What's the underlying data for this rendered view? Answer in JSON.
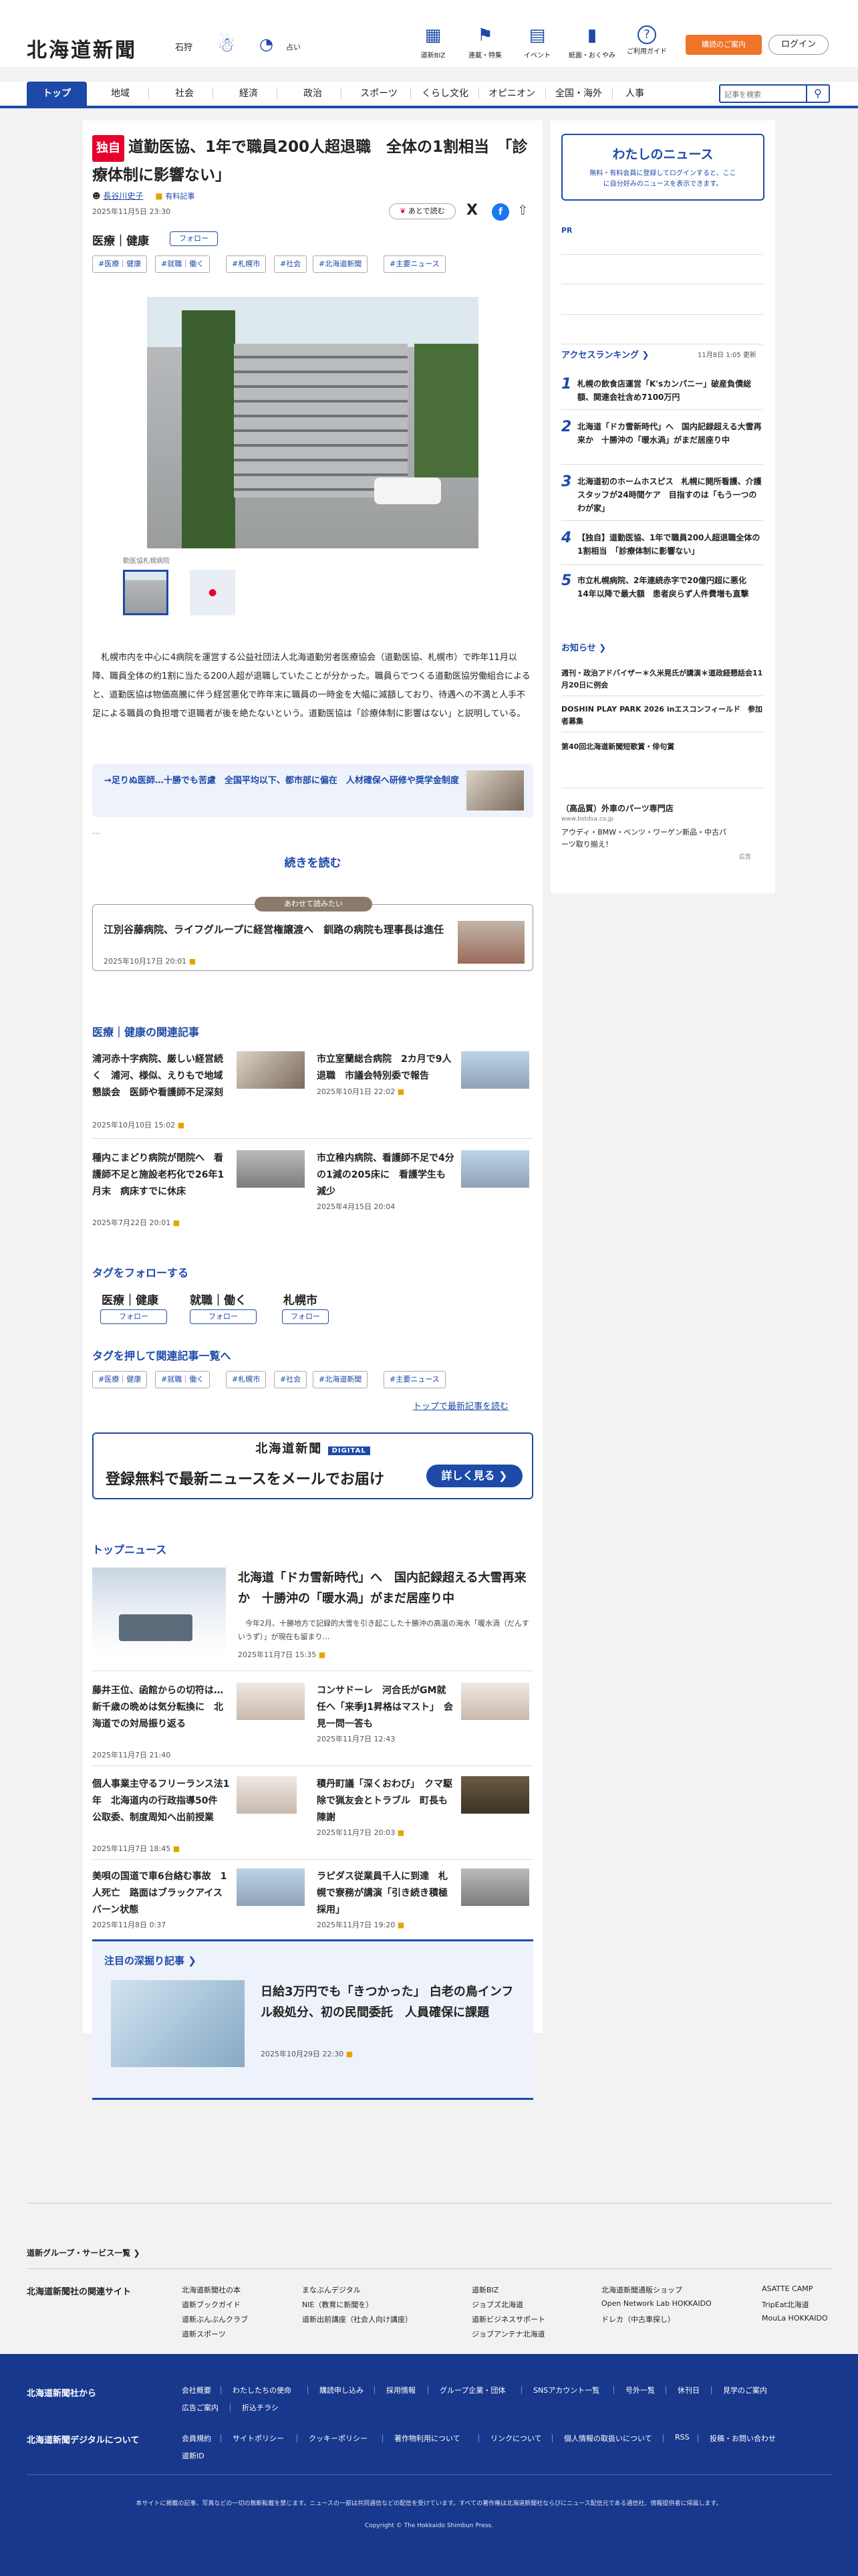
{
  "header": {
    "logo": "北海道新聞",
    "pref": "石狩",
    "weather_label": "☃",
    "rain_label": "占い",
    "icons": [
      {
        "icon": "building-icon",
        "glyph": "▦",
        "label": "道新BIZ"
      },
      {
        "icon": "flag-icon",
        "glyph": "⚑",
        "label": "連載・特集"
      },
      {
        "icon": "calendar-icon",
        "glyph": "▤",
        "label": "イベント"
      },
      {
        "icon": "newspaper-icon",
        "glyph": "▮",
        "label": "紙面・おくやみ"
      },
      {
        "icon": "help-icon",
        "glyph": "?",
        "label": "ご利用ガイド"
      }
    ],
    "subscribe": "購読のご案内",
    "login": "ログイン"
  },
  "nav": {
    "items": [
      "トップ",
      "地域",
      "社会",
      "経済",
      "政治",
      "スポーツ",
      "くらし文化",
      "オピニオン",
      "全国・海外",
      "人事"
    ],
    "search_placeholder": "記事を検索"
  },
  "article": {
    "badge": "独自",
    "title": "道勤医協、1年で職員200人超退職　全体の1割相当　「診療体制に影響ない」",
    "author": "長谷川史子",
    "author_badge": "有料記事",
    "date": "2025年11月5日 23:30",
    "save_later": "あとで読む",
    "category": "医療｜健康",
    "follow": "フォロー",
    "tags": [
      "#医療｜健康",
      "#就職｜働く",
      "#札幌市",
      "#社会",
      "#北海道新聞",
      "#主要ニュース"
    ],
    "photo_caption": "勤医協札幌病院",
    "body": "　札幌市内を中心に4病院を運営する公益社団法人北海道勤労者医療協会（道勤医協、札幌市）で昨年11月以降、職員全体の約1割に当たる200人超が退職していたことが分かった。職員らでつくる道勤医協労働組合によると、道勤医協は物価高騰に伴う経営悪化で昨年末に職員の一時金を大幅に減額しており、待遇への不満と人手不足による職員の負担増で退職者が後を絶たないという。道勤医協は「診療体制に影響はない」と説明している。",
    "promo": "→足りぬ医師…十勝でも苦慮　全国平均以下、都市部に偏在　人材確保へ研修や奨学金制度",
    "ellipsis": "…",
    "read_more": "続きを読む",
    "recommend_label": "あわせて読みたい",
    "recommend_title": "江別谷藤病院、ライフグループに経営権譲渡へ　釧路の病院も理事長は進任",
    "recommend_date": "2025年10月17日 20:01"
  },
  "related": {
    "heading": "医療｜健康の関連記事",
    "items": [
      {
        "title": "浦河赤十字病院、厳しい経営続く　浦河、様似、えりもで地域懇談会　医師や看護師不足深刻",
        "date": "2025年10月10日 15:02"
      },
      {
        "title": "市立室蘭総合病院　2カ月で9人退職　市議会特別委で報告",
        "date": "2025年10月1日 22:02"
      },
      {
        "title": "種内こまどり病院が閉院へ　看護師不足と施設老朽化で26年1月末　病床すでに休床",
        "date": "2025年7月22日 20:01"
      },
      {
        "title": "市立稚内病院、看護師不足で4分の1減の205床に　看護学生も減少",
        "date": "2025年4月15日 20:04"
      }
    ]
  },
  "follow_tags": {
    "heading": "タグをフォローする",
    "items": [
      "医療｜健康",
      "就職｜働く",
      "札幌市"
    ],
    "follow": "フォロー"
  },
  "tag_list": {
    "heading": "タグを押して関連記事一覧へ",
    "tags": [
      "#医療｜健康",
      "#就職｜働く",
      "#札幌市",
      "#社会",
      "#北海道新聞",
      "#主要ニュース"
    ],
    "top_link": "トップで最新記事を読む"
  },
  "banner": {
    "logo": "北海道新聞",
    "digital": "DIGITAL",
    "text": "登録無料で最新ニュースをメールでお届け",
    "button": "詳しく見る"
  },
  "top_news": {
    "heading": "トップニュース",
    "lead": {
      "title": "北海道「ドカ雪新時代」へ　国内記録超える大雪再来か　十勝沖の「暖水渦」がまだ居座り中",
      "excerpt": "　今年2月、十勝地方で記録的大雪を引き起こした十勝沖の高温の海水「暖水渦（だんすいうず）」が現在も留まり…",
      "date": "2025年11月7日 15:35"
    },
    "items": [
      {
        "title": "藤井王位、函館からの切符は…　新千歳の晩めは気分転換に　北海道での対局振り返る",
        "date": "2025年11月7日 21:40"
      },
      {
        "title": "コンサドーレ　河合氏がGM就任へ「来季J1昇格はマスト」　会見一問一答も",
        "date": "2025年11月7日 12:43"
      },
      {
        "title": "個人事業主守るフリーランス法1年　北海道内の行政指導50件　公取委、制度周知へ出前授業",
        "date": "2025年11月7日 18:45"
      },
      {
        "title": "積丹町議「深くおわび」　クマ駆除で猟友会とトラブル　町長も陳謝",
        "date": "2025年11月7日 20:03"
      },
      {
        "title": "美唄の国道で車6台絡む事故　1人死亡　路面はブラックアイスバーン状態",
        "date": "2025年11月8日 0:37"
      },
      {
        "title": "ラピダス従業員千人に到達　札幌で寮務が講演「引き続き積極採用」",
        "date": "2025年11月7日 19:20"
      }
    ]
  },
  "feature": {
    "heading": "注目の深掘り記事",
    "title": "日給3万円でも「きつかった」 白老の鳥インフル殺処分、初の民間委託　人員確保に課題",
    "date": "2025年10月29日 22:30"
  },
  "side": {
    "my_news_title": "わたしのニュース",
    "my_news_text": "無料・有料会員に登録してログインすると、ここに自分好みのニュースを表示できます。",
    "pr": "PR",
    "ranking_heading": "アクセスランキング",
    "ranking_time": "11月8日 1:05 更新",
    "ranking": [
      "札幌の飲食店運営「K'sカンパニー」破産負債総額、関連会社含め7100万円",
      "北海道「ドカ雪新時代」へ　国内記録超える大雪再来か　十勝沖の「暖水渦」がまだ居座り中",
      "北海道初のホームホスピス　札幌に開所看護、介護スタッフが24時間ケア　目指すのは「もう一つのわが家」",
      "【独自】道勤医協、1年で職員200人超退職全体の1割相当　「診療体制に影響ない」",
      "市立札幌病院、2年連続赤字で20億円超に悪化　14年以降で最大額　患者戻らず人件費増も直撃"
    ],
    "notice_heading": "お知らせ",
    "notices": [
      "週刊・政治アドバイザー＊久米晃氏が講演＊道政経懇話会11月20日に例会",
      "DOSHIN PLAY PARK 2026 inエスコンフィールド　参加者募集",
      "第40回北海道新聞短歌賞・俳句賞"
    ],
    "ad_title": "（高品質）外車のパーツ専門店",
    "ad_url": "www.bstdsa.co.jp",
    "ad_text": "アウディ・BMW・ベンツ・ワーゲン新品・中古パーツ取り揃え！",
    "ad_label": "広告"
  },
  "footer": {
    "group_link": "道新グループ・サービス一覧",
    "related_heading": "北海道新聞社の関連サイト",
    "cols": [
      [
        "北海道新聞社の本",
        "道新ブックガイド",
        "道新ぶんぶんクラブ",
        "道新スポーツ"
      ],
      [
        "まなぶんデジタル",
        "NIE（教育に新聞を）",
        "道新出前講座（社会人向け講座）"
      ],
      [
        "道新BIZ",
        "ジョブズ北海道",
        "道新ビジネスサポート",
        "ジョブアンテナ北海道"
      ],
      [
        "北海道新聞通販ショップ",
        "Open Network Lab HOKKAIDO",
        "ドレカ（中古車探し）"
      ],
      [
        "ASATTE CAMP",
        "TripEat北海道",
        "MouLa HOKKAIDO"
      ]
    ],
    "from_heading": "北海道新聞社から",
    "from_links": [
      "会社概要",
      "わたしたちの使命",
      "購読申し込み",
      "採用情報",
      "グループ企業・団体",
      "SNSアカウント一覧",
      "号外一覧",
      "休刊日",
      "見学のご案内",
      "広告ご案内",
      "折込チラシ"
    ],
    "digital_heading": "北海道新聞デジタルについて",
    "digital_links": [
      "会員規約",
      "サイトポリシー",
      "クッキーポリシー",
      "著作物利用について",
      "リンクについて",
      "個人情報の取扱いについて",
      "RSS",
      "投稿・お問い合わせ",
      "道新ID"
    ],
    "disclaimer": "本サイトに掲載の記事、写真などの一切の無断転載を禁じます。ニュースの一部は共同通信などの配信を受けています。すべての著作権は北海道新聞社ならびにニュース配信元である通信社、情報提供者に帰属します。",
    "copyright": "Copyright © The Hokkaido Shimbun Press."
  }
}
